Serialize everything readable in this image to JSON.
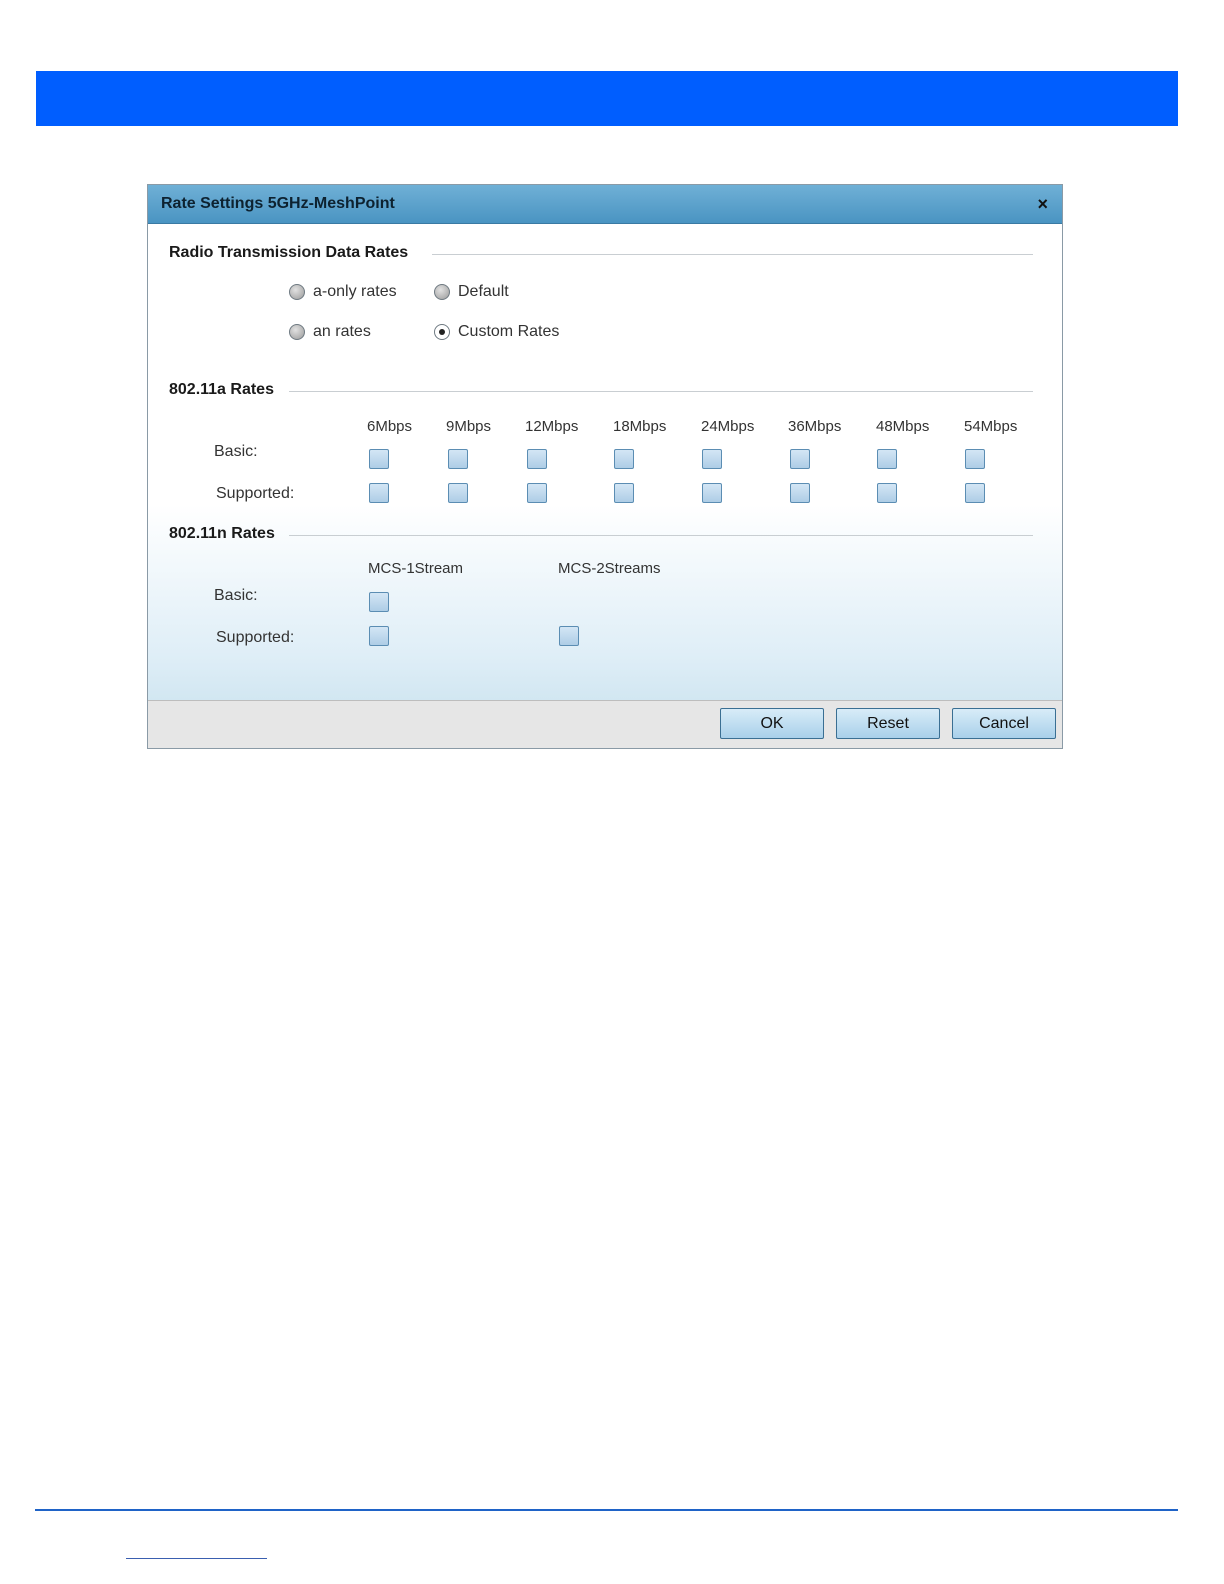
{
  "dialog": {
    "title": "Rate Settings 5GHz-MeshPoint",
    "close_symbol": "×"
  },
  "radio_section": {
    "title": "Radio Transmission Data Rates",
    "options": [
      {
        "label": "a-only rates",
        "selected": false
      },
      {
        "label": "Default",
        "selected": false
      },
      {
        "label": "an rates",
        "selected": false
      },
      {
        "label": "Custom Rates",
        "selected": true
      }
    ]
  },
  "a_rates": {
    "title": "802.11a  Rates",
    "columns": [
      "6Mbps",
      "9Mbps",
      "12Mbps",
      "18Mbps",
      "24Mbps",
      "36Mbps",
      "48Mbps",
      "54Mbps"
    ],
    "basic_label": "Basic:",
    "supported_label": "Supported:"
  },
  "n_rates": {
    "title": "802.11n Rates",
    "columns": [
      "MCS-1Stream",
      "MCS-2Streams"
    ],
    "basic_label": "Basic:",
    "supported_label": "Supported:"
  },
  "buttons": {
    "ok": "OK",
    "reset": "Reset",
    "cancel": "Cancel"
  },
  "colors": {
    "banner": "#005eff",
    "titlebar": "#4a94c2",
    "footer_rule": "#1f63c7"
  }
}
